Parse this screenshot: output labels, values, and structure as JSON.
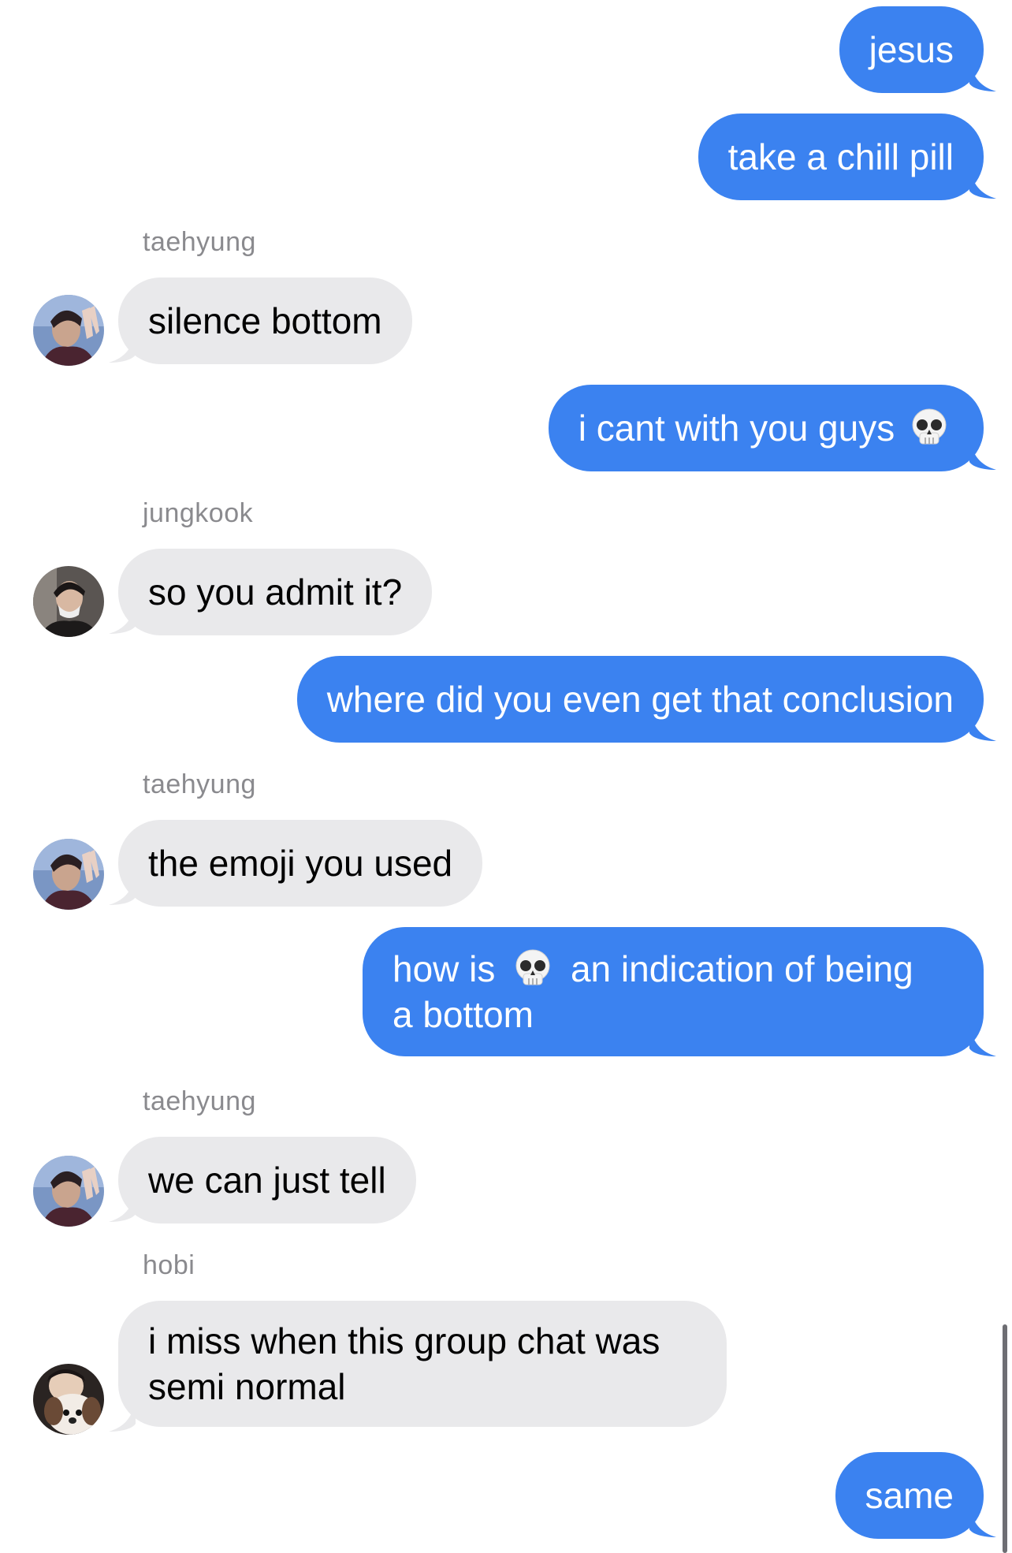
{
  "messages": [
    {
      "type": "out",
      "text": "jesus"
    },
    {
      "type": "out",
      "text": "take a chill pill"
    },
    {
      "type": "in",
      "sender": "taehyung",
      "text": "silence bottom",
      "avatar": "taehyung-avatar"
    },
    {
      "type": "out",
      "text": "i cant with you guys",
      "emoji": "skull-emoji"
    },
    {
      "type": "in",
      "sender": "jungkook",
      "text": "so you admit it?",
      "avatar": "jungkook-avatar"
    },
    {
      "type": "out",
      "text": "where did you even get that conclusion"
    },
    {
      "type": "in",
      "sender": "taehyung",
      "text": "the emoji you used",
      "avatar": "taehyung-avatar"
    },
    {
      "type": "out",
      "text_before": "how is",
      "emoji": "skull-emoji",
      "text_after": "an indication of being",
      "text_line2": "a bottom"
    },
    {
      "type": "in",
      "sender": "taehyung",
      "text": "we can just tell",
      "avatar": "taehyung-avatar"
    },
    {
      "type": "in",
      "sender": "hobi",
      "text_line1": "i miss when this group chat was",
      "text_line2": "semi normal",
      "avatar": "hobi-avatar"
    },
    {
      "type": "out",
      "text": "same"
    }
  ],
  "colors": {
    "outgoing_bubble": "#3b82f0",
    "incoming_bubble": "#e9e9eb",
    "sender_name": "#8a8a8e",
    "background": "#ffffff"
  }
}
